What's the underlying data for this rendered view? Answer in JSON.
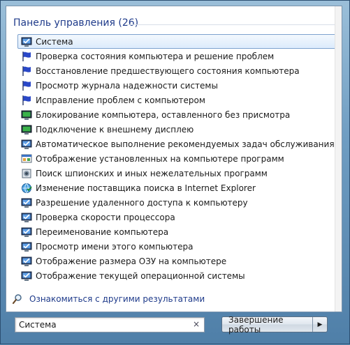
{
  "header": {
    "title": "Панель управления (26)"
  },
  "items": [
    {
      "label": "Система",
      "icon": "monitor-check-icon",
      "selected": true
    },
    {
      "label": "Проверка состояния компьютера и решение проблем",
      "icon": "flag-icon"
    },
    {
      "label": "Восстановление предшествующего состояния компьютера",
      "icon": "flag-icon"
    },
    {
      "label": "Просмотр журнала надежности системы",
      "icon": "flag-icon"
    },
    {
      "label": "Исправление проблем с компьютером",
      "icon": "flag-icon"
    },
    {
      "label": "Блокирование компьютера, оставленного без присмотра",
      "icon": "monitor-icon"
    },
    {
      "label": "Подключение к внешнему дисплею",
      "icon": "monitor-icon"
    },
    {
      "label": "Автоматическое выполнение рекомендуемых задач обслуживания",
      "icon": "monitor-check-icon"
    },
    {
      "label": "Отображение установленных на компьютере программ",
      "icon": "programs-icon"
    },
    {
      "label": "Поиск шпионских и иных нежелательных программ",
      "icon": "defender-icon"
    },
    {
      "label": "Изменение поставщика поиска в Internet Explorer",
      "icon": "internet-options-icon"
    },
    {
      "label": "Разрешение удаленного доступа к компьютеру",
      "icon": "monitor-check-icon"
    },
    {
      "label": "Проверка скорости процессора",
      "icon": "monitor-check-icon"
    },
    {
      "label": "Переименование компьютера",
      "icon": "monitor-check-icon"
    },
    {
      "label": "Просмотр имени этого компьютера",
      "icon": "monitor-check-icon"
    },
    {
      "label": "Отображение размера ОЗУ на компьютере",
      "icon": "monitor-check-icon"
    },
    {
      "label": "Отображение текущей операционной системы",
      "icon": "monitor-check-icon"
    }
  ],
  "more_results": {
    "label": "Ознакомиться с другими результатами",
    "icon": "magnifier-icon"
  },
  "search": {
    "value": "Система",
    "clear_glyph": "×"
  },
  "shutdown": {
    "label": "Завершение работы",
    "arrow_glyph": "▶"
  }
}
